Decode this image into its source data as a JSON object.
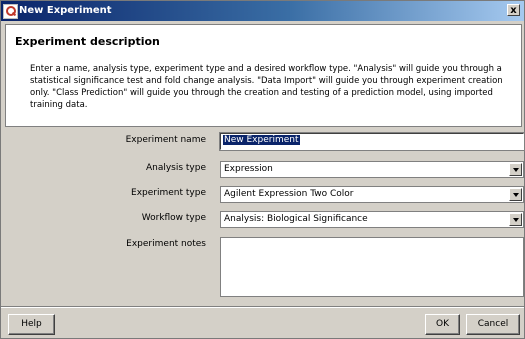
{
  "window": {
    "title": "New Experiment",
    "close_label": "x"
  },
  "description": {
    "heading": "Experiment description",
    "body": "Enter a name, analysis type, experiment type and a desired workflow type. \"Analysis\" will guide you through a statistical significance test and fold change analysis. \"Data Import\" will guide you through experiment creation only. \"Class Prediction\" will guide you through the creation and testing of a prediction model, using imported training data."
  },
  "form": {
    "experiment_name": {
      "label": "Experiment name",
      "value": "New Experiment"
    },
    "analysis_type": {
      "label": "Analysis type",
      "value": "Expression"
    },
    "experiment_type": {
      "label": "Experiment type",
      "value": "Agilent Expression Two Color"
    },
    "workflow_type": {
      "label": "Workflow type",
      "value": "Analysis: Biological Significance"
    },
    "experiment_notes": {
      "label": "Experiment notes",
      "value": ""
    }
  },
  "buttons": {
    "help": "Help",
    "ok": "OK",
    "cancel": "Cancel"
  }
}
